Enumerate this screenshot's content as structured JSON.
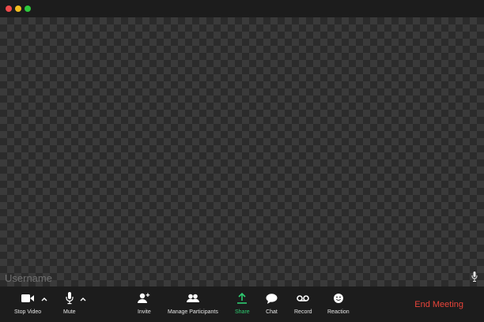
{
  "window": {
    "controls": [
      "close",
      "minimize",
      "maximize"
    ]
  },
  "video": {
    "username": "Username"
  },
  "toolbar": {
    "stop_video": "Stop Video",
    "mute": "Mute",
    "invite": "Invite",
    "manage_participants": "Manage Participants",
    "share": "Share",
    "chat": "Chat",
    "record": "Record",
    "reaction": "Reaction",
    "end_meeting": "End Meeting"
  },
  "colors": {
    "share_accent": "#2ecc71",
    "end_meeting": "#e8443a",
    "label_text": "#e6e6e6",
    "username_text": "#6f6f6f"
  },
  "icons": [
    "video-camera-icon",
    "microphone-icon",
    "add-person-icon",
    "participants-icon",
    "share-up-arrow-icon",
    "chat-bubble-icon",
    "record-icon",
    "smiley-icon",
    "chevron-up-icon"
  ]
}
